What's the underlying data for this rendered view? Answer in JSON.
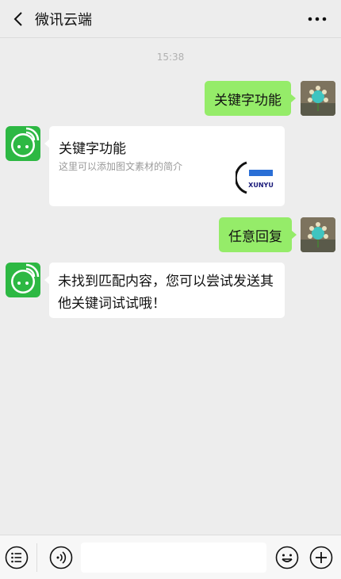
{
  "header": {
    "title": "微讯云端",
    "back_icon": "chevron-left-icon",
    "more_icon": "more-dots-icon"
  },
  "timestamp": "15:38",
  "messages": [
    {
      "side": "right",
      "text": "关键字功能"
    },
    {
      "side": "left",
      "type": "card",
      "title": "关键字功能",
      "desc": "这里可以添加图文素材的简介",
      "thumb_text": "XUNYU"
    },
    {
      "side": "right",
      "text": "任意回复"
    },
    {
      "side": "left",
      "text": "未找到匹配内容，您可以尝试发送其他关键词试试哦！"
    }
  ],
  "bottom": {
    "menu_icon": "list-menu-icon",
    "voice_icon": "voice-icon",
    "input_value": "",
    "emoji_icon": "emoji-icon",
    "plus_icon": "plus-icon"
  },
  "colors": {
    "background": "#ededed",
    "green_bubble": "#95ec69",
    "brand_green": "#2db843"
  }
}
